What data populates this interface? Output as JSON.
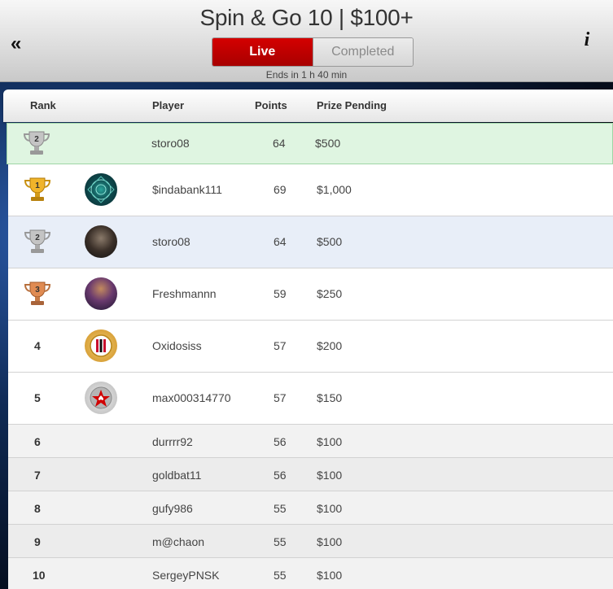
{
  "header": {
    "title": "Spin & Go 10 | $100+",
    "back_icon": "double-chevron-left-icon",
    "info_icon": "info-icon",
    "tabs": [
      {
        "label": "Live",
        "active": true
      },
      {
        "label": "Completed",
        "active": false
      }
    ],
    "ends_text": "Ends in 1 h 40 min"
  },
  "columns": {
    "rank": "Rank",
    "player": "Player",
    "points": "Points",
    "prize": "Prize Pending"
  },
  "highlight_row": {
    "rank": 2,
    "rank_label": "2",
    "player": "storo08",
    "points": "64",
    "prize": "$500"
  },
  "rows": [
    {
      "rank": 1,
      "rank_label": "1",
      "player": "$indabank111",
      "points": "69",
      "prize": "$1,000",
      "avatar": "mandala-avatar"
    },
    {
      "rank": 2,
      "rank_label": "2",
      "player": "storo08",
      "points": "64",
      "prize": "$500",
      "avatar": "portrait-avatar"
    },
    {
      "rank": 3,
      "rank_label": "3",
      "player": "Freshmannn",
      "points": "59",
      "prize": "$250",
      "avatar": "character-avatar"
    },
    {
      "rank": 4,
      "rank_label": "4",
      "player": "Oxidosiss",
      "points": "57",
      "prize": "$200",
      "avatar": "club-crest-avatar"
    },
    {
      "rank": 5,
      "rank_label": "5",
      "player": "max000314770",
      "points": "57",
      "prize": "$150",
      "avatar": "pokerstars-logo-avatar"
    },
    {
      "rank": 6,
      "rank_label": "6",
      "player": "durrrr92",
      "points": "56",
      "prize": "$100"
    },
    {
      "rank": 7,
      "rank_label": "7",
      "player": "goldbat11",
      "points": "56",
      "prize": "$100"
    },
    {
      "rank": 8,
      "rank_label": "8",
      "player": "gufy986",
      "points": "55",
      "prize": "$100"
    },
    {
      "rank": 9,
      "rank_label": "9",
      "player": "m@chaon",
      "points": "55",
      "prize": "$100"
    },
    {
      "rank": 10,
      "rank_label": "10",
      "player": "SergeyPNSK",
      "points": "55",
      "prize": "$100"
    }
  ],
  "colors": {
    "live_red": "#c40000",
    "highlight_green": "#dff5e1",
    "self_row_blue": "#e8eef8",
    "gold": "#e2a51c",
    "silver": "#b9b9b9",
    "bronze": "#d0814a"
  }
}
